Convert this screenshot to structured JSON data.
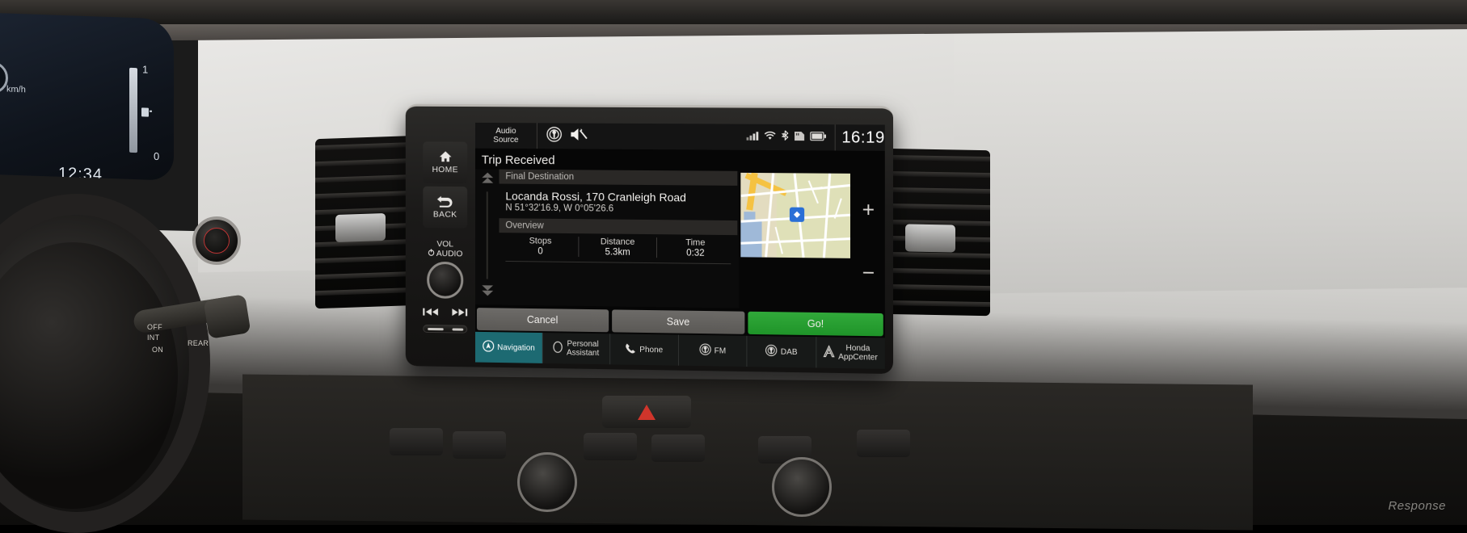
{
  "vehicle": {
    "cluster": {
      "speed_unit": "km/h",
      "clock": "12:34",
      "gauge_high": "1",
      "gauge_low": "0"
    },
    "stalk": {
      "off_label": "OFF",
      "int_label": "INT",
      "on_label": "ON",
      "rear_label": "REAR"
    },
    "watermark": "Response"
  },
  "headunit": {
    "hardkeys": [
      {
        "name": "home",
        "label": "HOME",
        "icon": "home-icon"
      },
      {
        "name": "back",
        "label": "BACK",
        "icon": "back-arrow-icon"
      }
    ],
    "volume": {
      "line1": "VOL",
      "line2": "AUDIO",
      "power_icon": "power-icon"
    },
    "transport": {
      "prev_icon": "skip-previous-icon",
      "next_icon": "skip-next-icon"
    }
  },
  "screen": {
    "statusbar": {
      "audio_source": {
        "line1": "Audio",
        "line2": "Source"
      },
      "fm_icon": "fm-radio-icon",
      "mute_icon": "speaker-mute-icon",
      "right_icons": [
        {
          "name": "cellular-signal-icon",
          "glyph": "signal"
        },
        {
          "name": "wifi-icon",
          "glyph": "wifi"
        },
        {
          "name": "bluetooth-icon",
          "glyph": "bluetooth"
        },
        {
          "name": "sd-card-icon",
          "glyph": "card"
        },
        {
          "name": "battery-icon",
          "glyph": "battery"
        }
      ],
      "clock": "16:19"
    },
    "title": "Trip Received",
    "sections": {
      "final_destination": {
        "header": "Final Destination",
        "name": "Locanda Rossi, 170 Cranleigh Road",
        "coords": "N 51°32'16.9, W 0°05'26.6"
      },
      "overview": {
        "header": "Overview",
        "metrics": [
          {
            "label": "Stops",
            "value": "0"
          },
          {
            "label": "Distance",
            "value": "5.3km"
          },
          {
            "label": "Time",
            "value": "0:32"
          }
        ]
      }
    },
    "scroll": {
      "up_icon": "scroll-up-icon",
      "down_icon": "scroll-down-icon"
    },
    "map": {
      "zoom_in": "+",
      "zoom_out": "−",
      "pin_icon": "destination-pin-icon"
    },
    "actions": [
      {
        "name": "cancel-button",
        "label": "Cancel",
        "style": "grey"
      },
      {
        "name": "save-button",
        "label": "Save",
        "style": "grey"
      },
      {
        "name": "go-button",
        "label": "Go!",
        "style": "green"
      }
    ],
    "tabs": [
      {
        "name": "tab-navigation",
        "label": "Navigation",
        "icon": "navigation-compass-icon",
        "active": true
      },
      {
        "name": "tab-personal-assistant",
        "label": "Personal\nAssistant",
        "icon": "assistant-icon",
        "active": false
      },
      {
        "name": "tab-phone",
        "label": "Phone",
        "icon": "phone-icon",
        "active": false
      },
      {
        "name": "tab-fm",
        "label": "FM",
        "icon": "radio-icon",
        "active": false
      },
      {
        "name": "tab-dab",
        "label": "DAB",
        "icon": "radio-icon",
        "active": false
      },
      {
        "name": "tab-honda-appcenter",
        "label": "Honda\nAppCenter",
        "icon": "honda-a-icon",
        "active": false
      }
    ]
  },
  "colors": {
    "accent_teal": "#1d6a72",
    "go_green": "#31a93a",
    "screen_bg": "#060606",
    "section_head": "#2a2826"
  }
}
